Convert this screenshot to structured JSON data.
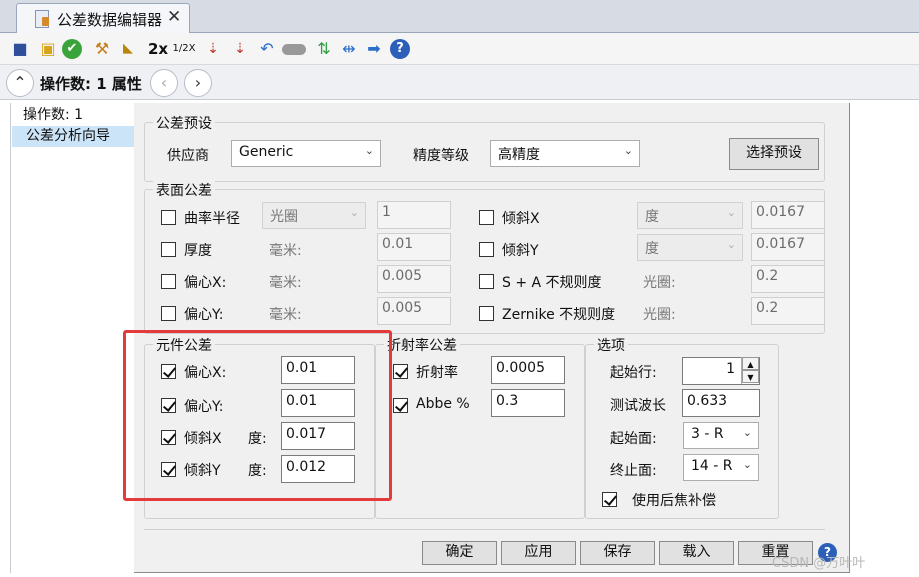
{
  "tab": {
    "title": "公差数据编辑器",
    "close": "✕"
  },
  "toolbar": {
    "icons": [
      "save-icon",
      "load-icon",
      "check-icon",
      "wizard-icon",
      "ruler-icon",
      "double-icon",
      "half-icon",
      "sort-num-icon",
      "sort-alpha-icon",
      "undo-icon",
      "toggle-icon",
      "swap-icon",
      "shrink-icon",
      "forward-icon",
      "help-icon"
    ],
    "double_label": "2x",
    "half_label": "1/2X"
  },
  "nav": {
    "text": "操作数: 1 属性",
    "back": "‹",
    "forward": "›"
  },
  "left_panel": {
    "count": "操作数: 1",
    "item": "公差分析向导"
  },
  "preset": {
    "group": "公差预设",
    "supplier_label": "供应商",
    "supplier_value": "Generic",
    "precision_label": "精度等级",
    "precision_value": "高精度",
    "select_button": "选择预设"
  },
  "surface": {
    "group": "表面公差",
    "rows_left": [
      {
        "label": "曲率半径",
        "unit": "光圈",
        "value": "1"
      },
      {
        "label": "厚度",
        "unit": "毫米:",
        "value": "0.01"
      },
      {
        "label": "偏心X:",
        "unit": "毫米:",
        "value": "0.005"
      },
      {
        "label": "偏心Y:",
        "unit": "毫米:",
        "value": "0.005"
      }
    ],
    "rows_right": [
      {
        "label": "倾斜X",
        "unit": "度",
        "value": "0.0167"
      },
      {
        "label": "倾斜Y",
        "unit": "度",
        "value": "0.0167"
      },
      {
        "label": "S + A 不规则度",
        "unit": "光圈:",
        "value": "0.2"
      },
      {
        "label": "Zernike 不规则度",
        "unit": "光圈:",
        "value": "0.2"
      }
    ]
  },
  "element": {
    "group": "元件公差",
    "rows": [
      {
        "label": "偏心X:",
        "unit": "",
        "value": "0.01"
      },
      {
        "label": "偏心Y:",
        "unit": "",
        "value": "0.01"
      },
      {
        "label": "倾斜X",
        "unit": "度:",
        "value": "0.017"
      },
      {
        "label": "倾斜Y",
        "unit": "度:",
        "value": "0.012"
      }
    ]
  },
  "index": {
    "group": "折射率公差",
    "rows": [
      {
        "label": "折射率",
        "value": "0.0005"
      },
      {
        "label": "Abbe %",
        "value": "0.3"
      }
    ]
  },
  "options": {
    "group": "选项",
    "start_row_label": "起始行:",
    "start_row_value": "1",
    "wavelength_label": "测试波长",
    "wavelength_value": "0.633",
    "start_surface_label": "起始面:",
    "start_surface_value": "3 - R",
    "end_surface_label": "终止面:",
    "end_surface_value": "14 - R",
    "backfocus_label": "使用后焦补偿"
  },
  "buttons": {
    "ok": "确定",
    "apply": "应用",
    "save": "保存",
    "load": "载入",
    "reset": "重置"
  },
  "watermark": "CSDN @万叶叶"
}
